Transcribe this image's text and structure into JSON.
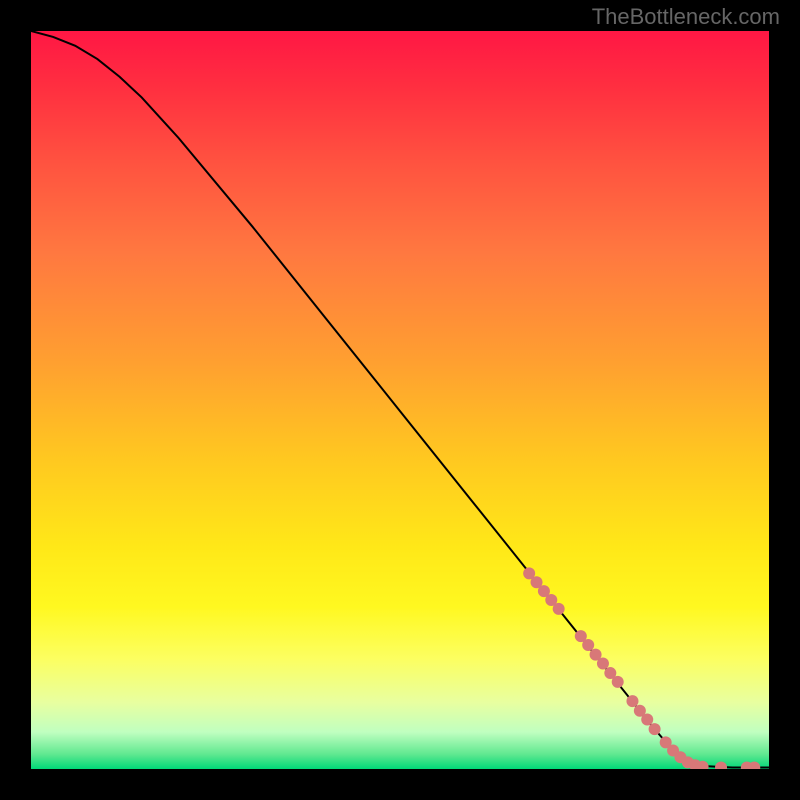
{
  "watermark": "TheBottleneck.com",
  "chart_data": {
    "type": "line",
    "title": "",
    "xlabel": "",
    "ylabel": "",
    "xlim": [
      0,
      100
    ],
    "ylim": [
      0,
      100
    ],
    "grid": false,
    "series": [
      {
        "name": "curve",
        "style": "line",
        "color": "#000000",
        "points": [
          {
            "x": 0,
            "y": 100
          },
          {
            "x": 3,
            "y": 99.2
          },
          {
            "x": 6,
            "y": 98
          },
          {
            "x": 9,
            "y": 96.2
          },
          {
            "x": 12,
            "y": 93.8
          },
          {
            "x": 15,
            "y": 91
          },
          {
            "x": 20,
            "y": 85.5
          },
          {
            "x": 30,
            "y": 73.5
          },
          {
            "x": 40,
            "y": 61
          },
          {
            "x": 50,
            "y": 48.5
          },
          {
            "x": 60,
            "y": 36
          },
          {
            "x": 70,
            "y": 23.5
          },
          {
            "x": 78,
            "y": 13.5
          },
          {
            "x": 84,
            "y": 6
          },
          {
            "x": 87,
            "y": 2.5
          },
          {
            "x": 89,
            "y": 1
          },
          {
            "x": 91,
            "y": 0.4
          },
          {
            "x": 95,
            "y": 0.2
          },
          {
            "x": 100,
            "y": 0.2
          }
        ]
      },
      {
        "name": "markers",
        "style": "scatter",
        "color": "#d87878",
        "points": [
          {
            "x": 67.5,
            "y": 26.5
          },
          {
            "x": 68.5,
            "y": 25.3
          },
          {
            "x": 69.5,
            "y": 24.1
          },
          {
            "x": 70.5,
            "y": 22.9
          },
          {
            "x": 71.5,
            "y": 21.7
          },
          {
            "x": 74.5,
            "y": 18.0
          },
          {
            "x": 75.5,
            "y": 16.8
          },
          {
            "x": 76.5,
            "y": 15.5
          },
          {
            "x": 77.5,
            "y": 14.3
          },
          {
            "x": 78.5,
            "y": 13.0
          },
          {
            "x": 79.5,
            "y": 11.8
          },
          {
            "x": 81.5,
            "y": 9.2
          },
          {
            "x": 82.5,
            "y": 7.9
          },
          {
            "x": 83.5,
            "y": 6.7
          },
          {
            "x": 84.5,
            "y": 5.4
          },
          {
            "x": 86.0,
            "y": 3.6
          },
          {
            "x": 87.0,
            "y": 2.5
          },
          {
            "x": 88.0,
            "y": 1.6
          },
          {
            "x": 89.0,
            "y": 0.9
          },
          {
            "x": 90.0,
            "y": 0.5
          },
          {
            "x": 91.0,
            "y": 0.3
          },
          {
            "x": 93.5,
            "y": 0.2
          },
          {
            "x": 97.0,
            "y": 0.2
          },
          {
            "x": 98.0,
            "y": 0.2
          }
        ]
      }
    ],
    "background": {
      "type": "vertical-gradient",
      "stops": [
        {
          "offset": 0,
          "color": "#ff1744"
        },
        {
          "offset": 50,
          "color": "#ffc820"
        },
        {
          "offset": 85,
          "color": "#fcff60"
        },
        {
          "offset": 100,
          "color": "#00d878"
        }
      ]
    }
  }
}
